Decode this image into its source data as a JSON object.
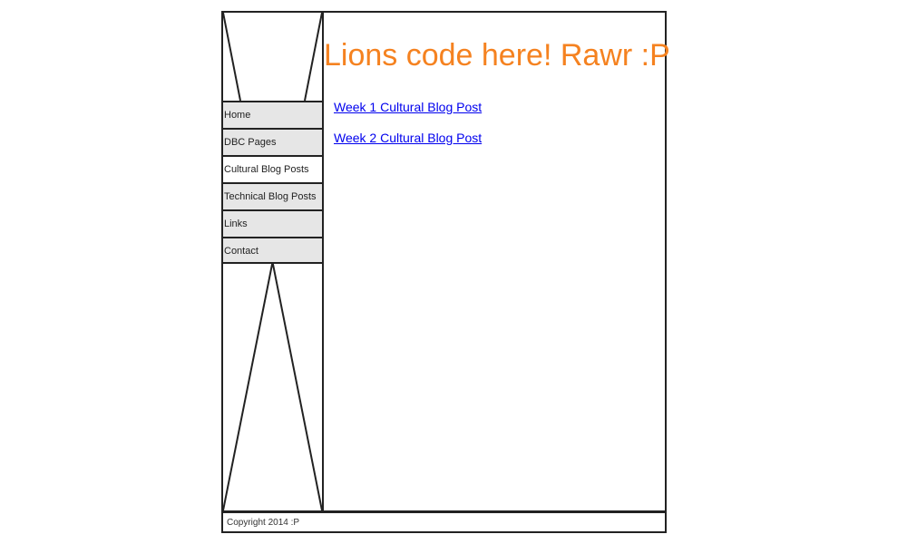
{
  "header": {
    "title": "Lions code here! Rawr :P",
    "title_color": "#f58220"
  },
  "nav": {
    "items": [
      {
        "label": "Home",
        "active": false
      },
      {
        "label": "DBC Pages",
        "active": false
      },
      {
        "label": "Cultural Blog Posts",
        "active": true
      },
      {
        "label": "Technical Blog Posts",
        "active": false
      },
      {
        "label": "Links",
        "active": false
      },
      {
        "label": "Contact",
        "active": false
      }
    ]
  },
  "main": {
    "posts": [
      {
        "label": "Week 1 Cultural Blog Post"
      },
      {
        "label": "Week 2 Cultural Blog Post"
      }
    ]
  },
  "footer": {
    "copyright": "Copyright 2014 :P"
  },
  "colors": {
    "link": "#0000ee",
    "nav_bg": "#e6e6e6",
    "border": "#222222"
  }
}
